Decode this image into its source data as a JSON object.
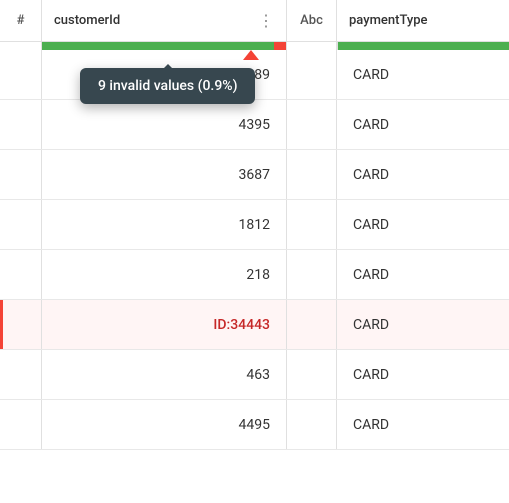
{
  "header": {
    "index_symbol": "#",
    "customer_id_label": "customerId",
    "abc_label": "Abc",
    "payment_type_label": "paymentType",
    "dots_icon": "⋮"
  },
  "tooltip": {
    "text": "9 invalid values (0.9%)"
  },
  "rows": [
    {
      "customer_id": "5089",
      "payment_type": "CARD",
      "invalid": false
    },
    {
      "customer_id": "4395",
      "payment_type": "CARD",
      "invalid": false
    },
    {
      "customer_id": "3687",
      "payment_type": "CARD",
      "invalid": false
    },
    {
      "customer_id": "1812",
      "payment_type": "CARD",
      "invalid": false
    },
    {
      "customer_id": "218",
      "payment_type": "CARD",
      "invalid": false
    },
    {
      "customer_id": "ID:34443",
      "payment_type": "CARD",
      "invalid": true
    },
    {
      "customer_id": "463",
      "payment_type": "CARD",
      "invalid": false
    },
    {
      "customer_id": "4495",
      "payment_type": "CARD",
      "invalid": false
    }
  ]
}
